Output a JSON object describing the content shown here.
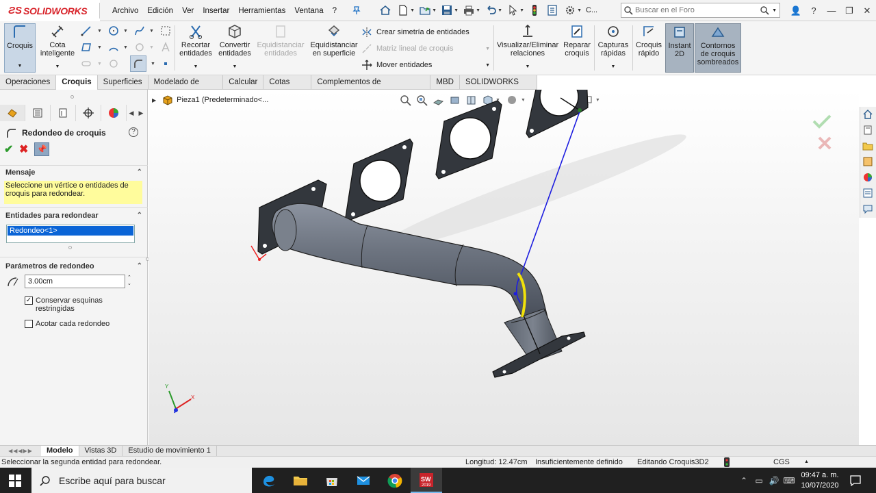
{
  "app": {
    "brand": "SOLIDWORKS",
    "menus": [
      "Archivo",
      "Edición",
      "Ver",
      "Insertar",
      "Herramientas",
      "Ventana",
      "?"
    ],
    "qat_overflow": "C...",
    "search_placeholder": "Buscar en el Foro",
    "accent_color": "#d8232a"
  },
  "command_manager": {
    "croquis": "Croquis",
    "cota_inteligente": "Cota\ninteligente",
    "recortar": "Recortar\nentidades",
    "convertir": "Convertir\nentidades",
    "equidistanciar": "Equidistanciar\nentidades",
    "equidistanciar_superficie": "Equidistanciar\nen superficie",
    "simetria": "Crear simetría de entidades",
    "matriz": "Matriz lineal de croquis",
    "mover": "Mover entidades",
    "relaciones": "Visualizar/Eliminar\nrelaciones",
    "reparar": "Reparar\ncroquis",
    "capturas": "Capturas\nrápidas",
    "croquis_rapido": "Croquis\nrápido",
    "instant2d": "Instant\n2D",
    "contornos": "Contornos\nde croquis\nsombreados"
  },
  "tabs": [
    "Operaciones",
    "Croquis",
    "Superficies",
    "Modelado de mallas",
    "Calcular",
    "Cotas MBD",
    "Complementos de SOLIDWORKS",
    "MBD",
    "SOLIDWORKS CAM"
  ],
  "active_tab": "Croquis",
  "property_manager": {
    "title": "Redondeo de croquis",
    "help": "?",
    "message_header": "Mensaje",
    "message": "Seleccione un vértice o entidades de croquis para redondear.",
    "entities_header": "Entidades para redondear",
    "entities": [
      "Redondeo<1>"
    ],
    "params_header": "Parámetros de redondeo",
    "radius_value": "3.00cm",
    "keep_corners_label": "Conservar esquinas restringidas",
    "keep_corners_checked": true,
    "dim_each_label": "Acotar cada redondeo",
    "dim_each_checked": false
  },
  "graphics": {
    "tree_root": "Pieza1  (Predeterminado<...",
    "triad_x": "X",
    "triad_y": "Y"
  },
  "bottom_tabs": [
    "Modelo",
    "Vistas 3D",
    "Estudio de movimiento 1"
  ],
  "status": {
    "hint": "Seleccionar la segunda entidad para redondear.",
    "length": "Longitud: 12.47cm",
    "definition": "Insuficientemente definido",
    "editing": "Editando Croquis3D2",
    "units": "CGS"
  },
  "taskbar": {
    "search_placeholder": "Escribe aquí para buscar",
    "time": "09:47 a. m.",
    "date": "10/07/2020",
    "sw_badge": "2019"
  }
}
